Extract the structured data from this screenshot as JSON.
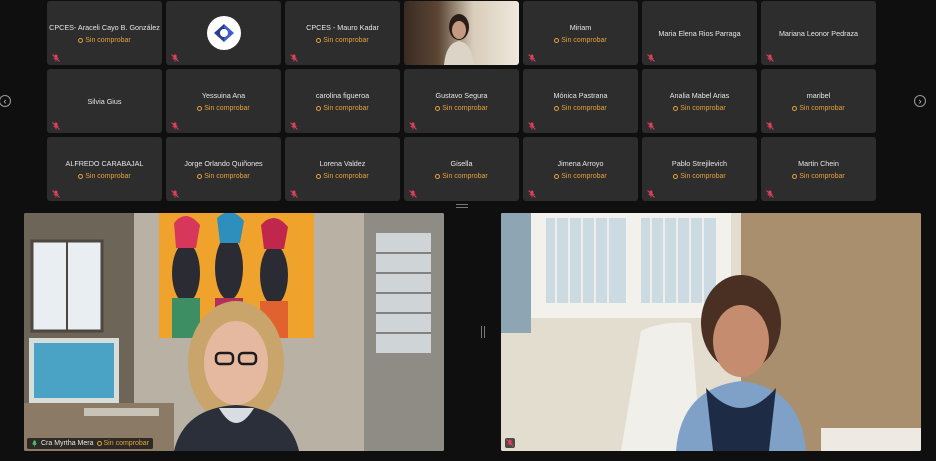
{
  "meeting": {
    "pending_status": "Sin comprobar",
    "accent_status_color": "#e3a23b",
    "muted_color": "#e0405a",
    "gallery": [
      {
        "name": "CPCES- Araceli Cayo B. González",
        "status": "Sin comprobar",
        "kind": "text"
      },
      {
        "name": "",
        "status": "",
        "kind": "logo"
      },
      {
        "name": "CPCES - Mauro Kadar",
        "status": "Sin comprobar",
        "kind": "text"
      },
      {
        "name": "",
        "status": "",
        "kind": "video"
      },
      {
        "name": "Miriam",
        "status": "Sin comprobar",
        "kind": "text"
      },
      {
        "name": "Maria Elena Rios Parraga",
        "status": "",
        "kind": "text"
      },
      {
        "name": "Mariana Leonor Pedraza",
        "status": "",
        "kind": "text"
      },
      {
        "name": "Silvia Gius",
        "status": "",
        "kind": "text"
      },
      {
        "name": "Yessuina Ana",
        "status": "Sin comprobar",
        "kind": "text"
      },
      {
        "name": "carolina figueroa",
        "status": "Sin comprobar",
        "kind": "text"
      },
      {
        "name": "Gustavo Segura",
        "status": "Sin comprobar",
        "kind": "text"
      },
      {
        "name": "Mónica Pastrana",
        "status": "Sin comprobar",
        "kind": "text"
      },
      {
        "name": "Analia Mabel Arias",
        "status": "Sin comprobar",
        "kind": "text"
      },
      {
        "name": "maribel",
        "status": "Sin comprobar",
        "kind": "text"
      },
      {
        "name": "ALFREDO CARABAJAL",
        "status": "Sin comprobar",
        "kind": "text"
      },
      {
        "name": "Jorge Orlando Quiñones",
        "status": "Sin comprobar",
        "kind": "text"
      },
      {
        "name": "Lorena Valdez",
        "status": "Sin comprobar",
        "kind": "text"
      },
      {
        "name": "Gisella",
        "status": "Sin comprobar",
        "kind": "text"
      },
      {
        "name": "Jimena Arroyo",
        "status": "Sin comprobar",
        "kind": "text"
      },
      {
        "name": "Pablo Strejilevich",
        "status": "Sin comprobar",
        "kind": "text"
      },
      {
        "name": "Martin Chein",
        "status": "Sin comprobar",
        "kind": "text"
      }
    ],
    "speakers": [
      {
        "name": "Cra Myrtha Mera",
        "status": "Sin comprobar"
      },
      {
        "name": "",
        "status": ""
      }
    ],
    "nav": {
      "prev": "‹",
      "next": "›"
    }
  }
}
